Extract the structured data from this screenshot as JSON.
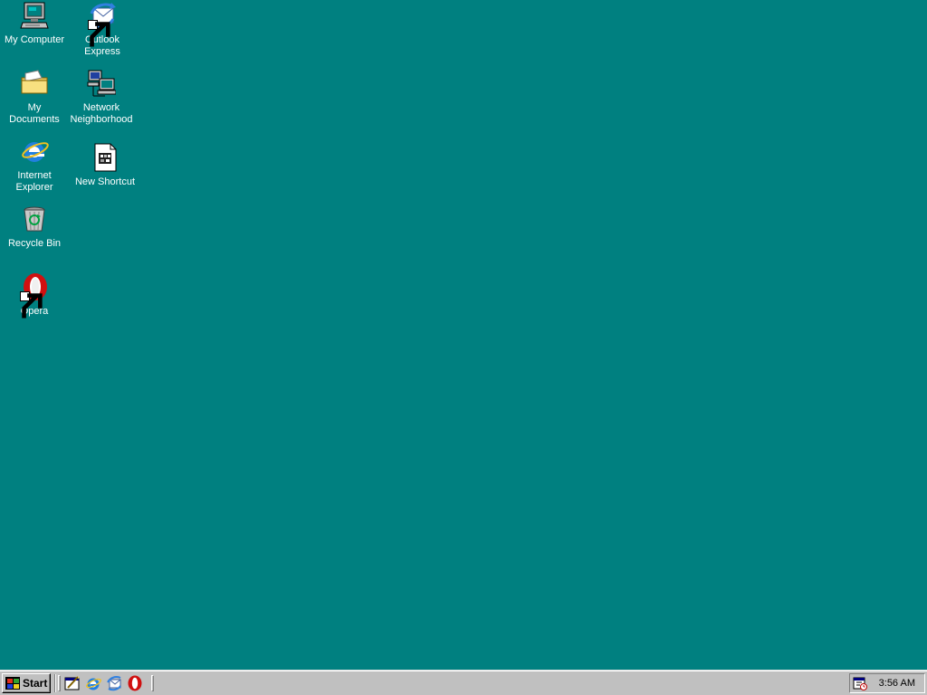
{
  "desktop": {
    "background_color": "#008080",
    "icons": [
      {
        "label": "My Computer",
        "icon": "computer-icon"
      },
      {
        "label": "My Documents",
        "icon": "folder-icon"
      },
      {
        "label": "Internet Explorer",
        "icon": "internet-explorer-icon"
      },
      {
        "label": "Recycle Bin",
        "icon": "recycle-bin-icon"
      },
      {
        "label": "Opera",
        "icon": "opera-icon",
        "shortcut": true
      },
      {
        "label": "Outlook Express",
        "icon": "outlook-express-icon",
        "shortcut": true
      },
      {
        "label": "Network Neighborhood",
        "icon": "network-icon"
      },
      {
        "label": "New Shortcut",
        "icon": "document-icon"
      }
    ]
  },
  "taskbar": {
    "start_label": "Start",
    "quick_launch": [
      {
        "icon": "show-desktop-icon"
      },
      {
        "icon": "internet-explorer-icon"
      },
      {
        "icon": "outlook-express-icon"
      },
      {
        "icon": "opera-icon"
      }
    ],
    "tray": {
      "icon": "scheduler-icon",
      "time": "3:56 AM"
    }
  }
}
